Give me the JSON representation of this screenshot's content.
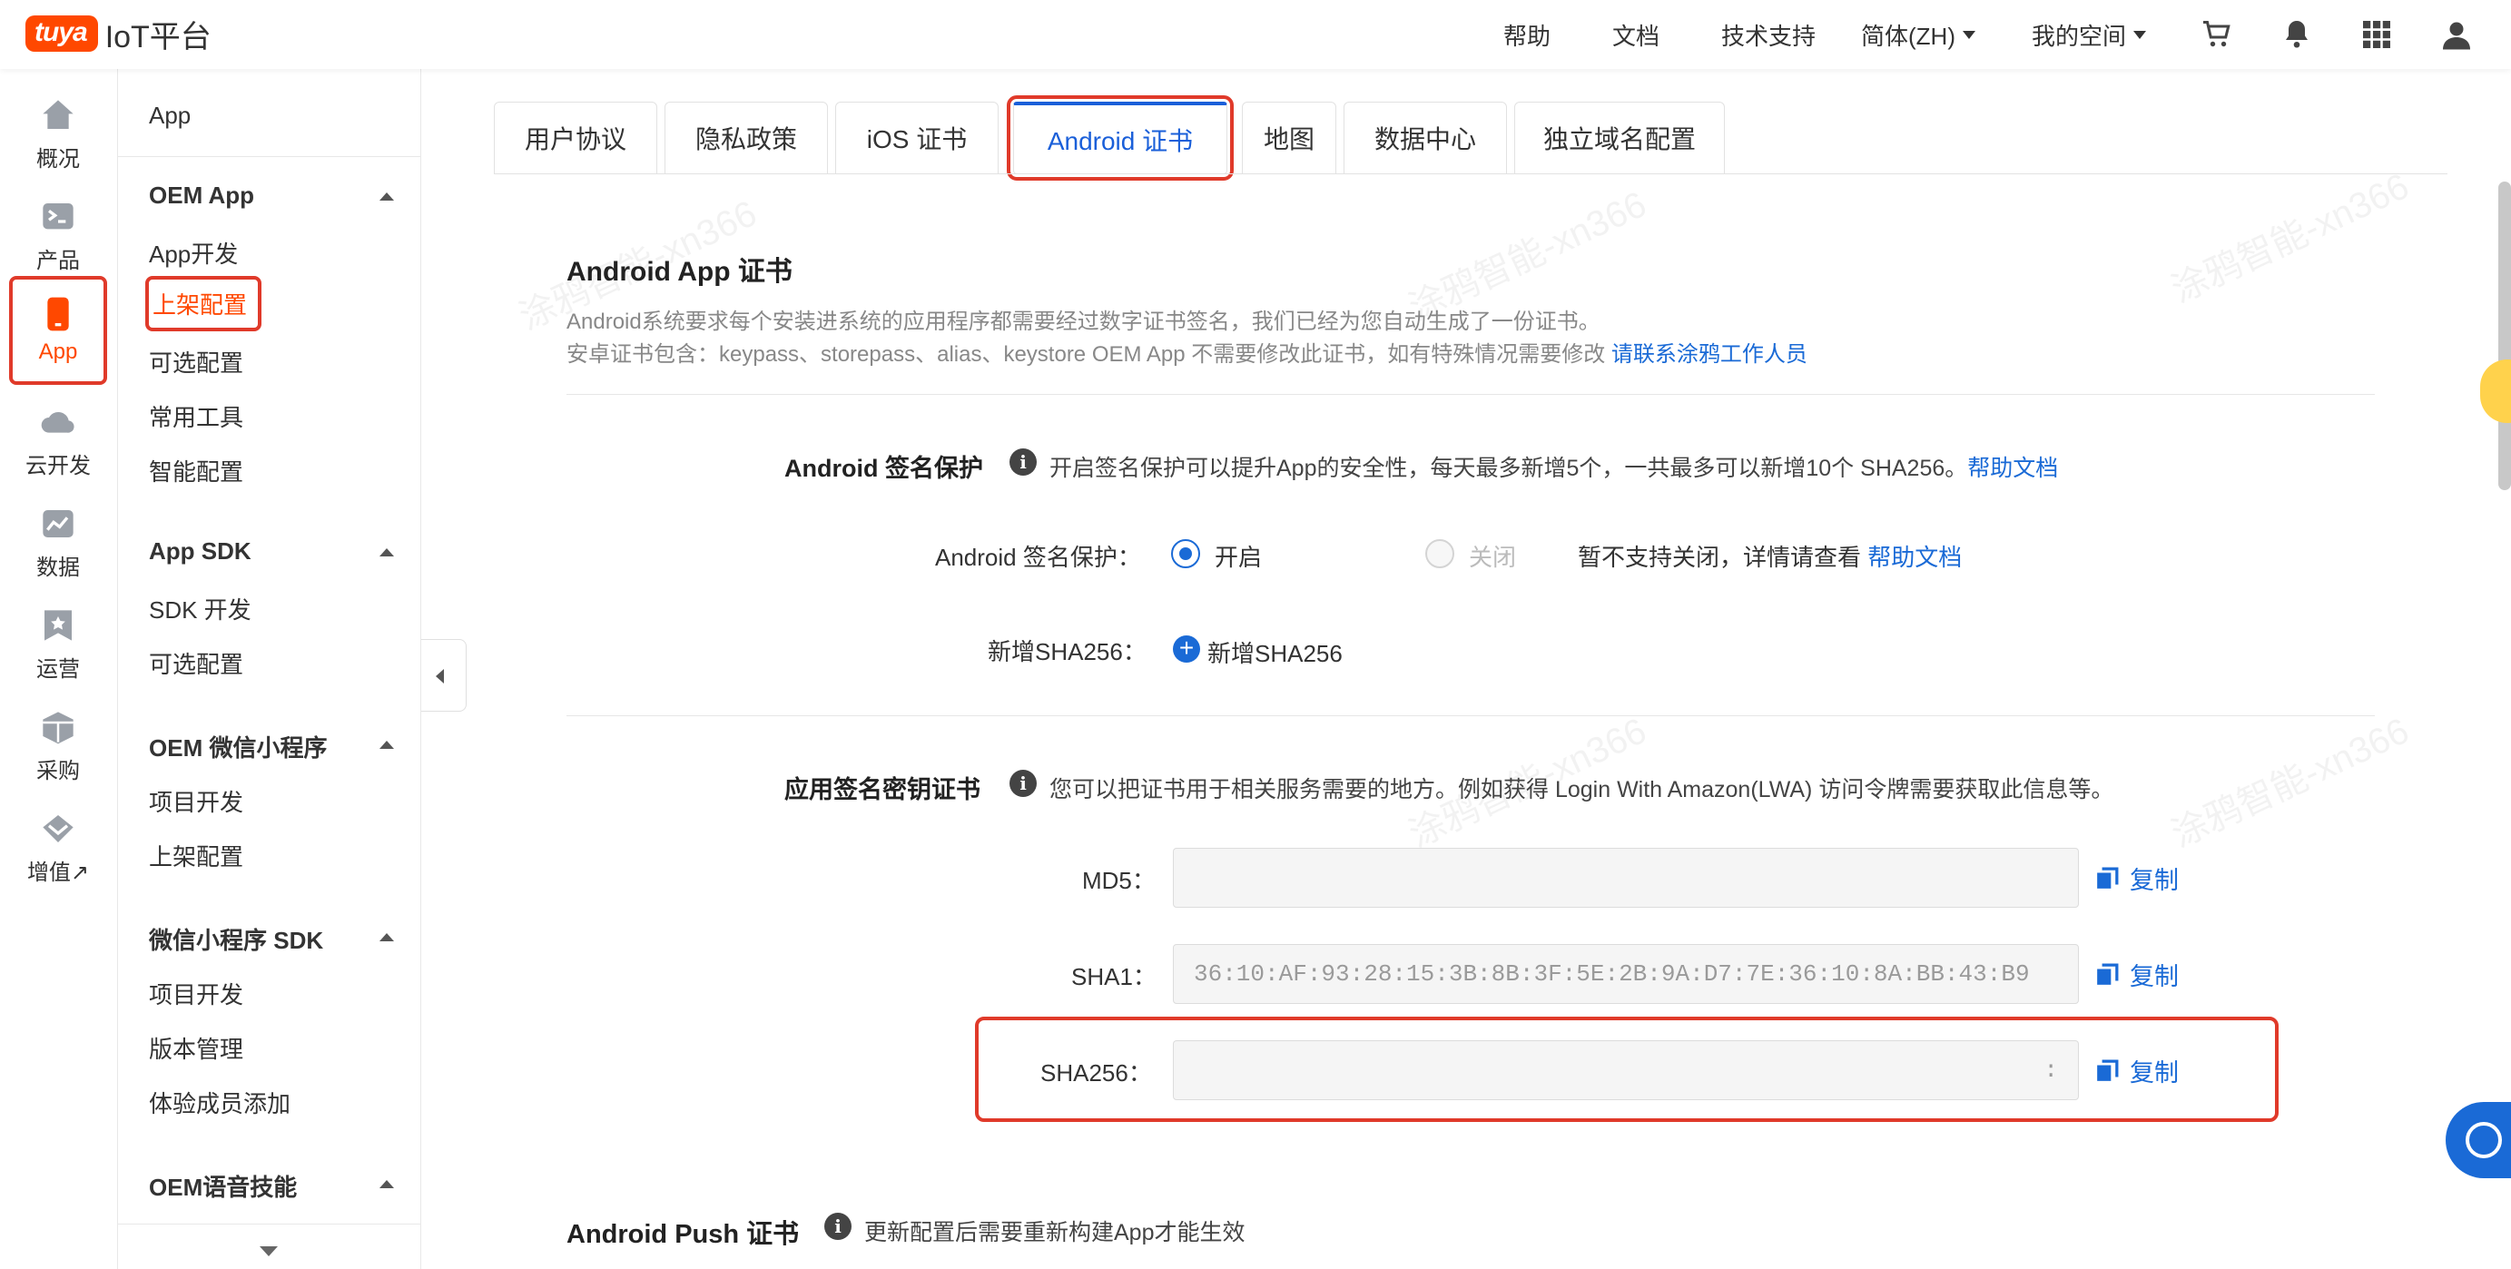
{
  "app": {
    "brand": "tuya",
    "title": "IoT平台"
  },
  "topnav": {
    "help": "帮助",
    "docs": "文档",
    "support": "技术支持",
    "lang": "简体(ZH)",
    "space": "我的空间"
  },
  "rail": [
    {
      "label": "概况",
      "icon": "home-icon"
    },
    {
      "label": "产品",
      "icon": "terminal-icon"
    },
    {
      "label": "App",
      "icon": "phone-icon"
    },
    {
      "label": "云开发",
      "icon": "cloud-icon"
    },
    {
      "label": "数据",
      "icon": "chart-icon"
    },
    {
      "label": "运营",
      "icon": "star-icon"
    },
    {
      "label": "采购",
      "icon": "box-icon"
    },
    {
      "label": "增值↗",
      "icon": "diamond-icon"
    }
  ],
  "subnav": {
    "section": "App",
    "groups": [
      {
        "title": "OEM App",
        "items": [
          "App开发",
          "上架配置",
          "可选配置",
          "常用工具",
          "智能配置"
        ]
      },
      {
        "title": "App SDK",
        "items": [
          "SDK 开发",
          "可选配置"
        ]
      },
      {
        "title": "OEM 微信小程序",
        "items": [
          "项目开发",
          "上架配置"
        ]
      },
      {
        "title": "微信小程序 SDK",
        "items": [
          "项目开发",
          "版本管理",
          "体验成员添加"
        ]
      },
      {
        "title": "OEM语音技能",
        "items": []
      }
    ]
  },
  "tabs": [
    "用户协议",
    "隐私政策",
    "iOS 证书",
    "Android 证书",
    "地图",
    "数据中心",
    "独立域名配置"
  ],
  "cert": {
    "title": "Android App 证书",
    "desc1": "Android系统要求每个安装进系统的应用程序都需要经过数字证书签名，我们已经为您自动生成了一份证书。",
    "desc2": "安卓证书包含：keypass、storepass、alias、keystore OEM App 不需要修改此证书，如有特殊情况需要修改 ",
    "desc2_link": "请联系涂鸦工作人员"
  },
  "sign_protect": {
    "heading": "Android 签名保护",
    "info": "开启签名保护可以提升App的安全性，每天最多新增5个，一共最多可以新增10个 SHA256。",
    "info_link": "帮助文档",
    "label": "Android 签名保护：",
    "on": "开启",
    "off": "关闭",
    "note": "暂不支持关闭，详情请查看 ",
    "note_link": "帮助文档",
    "add_label": "新增SHA256：",
    "add_button": "新增SHA256"
  },
  "key_cert": {
    "heading": "应用签名密钥证书",
    "info": "您可以把证书用于相关服务需要的地方。例如获得 Login With Amazon(LWA) 访问令牌需要获取此信息等。",
    "md5_label": "MD5：",
    "md5_value": "",
    "sha1_label": "SHA1：",
    "sha1_value": "36:10:AF:93:28:15:3B:8B:3F:5E:2B:9A:D7:7E:36:10:8A:BB:43:B9",
    "sha256_label": "SHA256：",
    "sha256_value": ":",
    "copy": "复制"
  },
  "push": {
    "heading": "Android Push 证书",
    "info": "更新配置后需要重新构建App才能生效"
  },
  "watermark": "涂鸦智能-xn366",
  "colors": {
    "brand": "#ff4800",
    "link": "#1a6ad6",
    "highlight": "#e03a2a"
  }
}
